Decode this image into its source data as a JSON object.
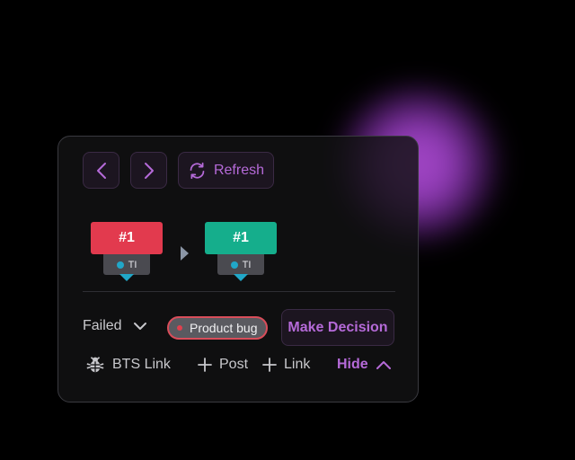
{
  "toolbar": {
    "prev_icon": "chevron-left-icon",
    "next_icon": "chevron-right-icon",
    "refresh_icon": "refresh-icon",
    "refresh_label": "Refresh"
  },
  "pipeline": {
    "steps": [
      {
        "label": "#1",
        "tag": "TI",
        "color": "#e23a4e"
      },
      {
        "label": "#1",
        "tag": "TI",
        "color": "#15ae8c"
      }
    ]
  },
  "result": {
    "status": "Failed",
    "badge": "Product bug",
    "decision_label": "Make Decision"
  },
  "footer": {
    "bts_label": "BTS Link",
    "post_label": "Post",
    "link_label": "Link",
    "hide_label": "Hide"
  },
  "colors": {
    "accent": "#b56ad8",
    "failed": "#e23a4e",
    "passed": "#15ae8c",
    "marker": "#21a7c8"
  }
}
